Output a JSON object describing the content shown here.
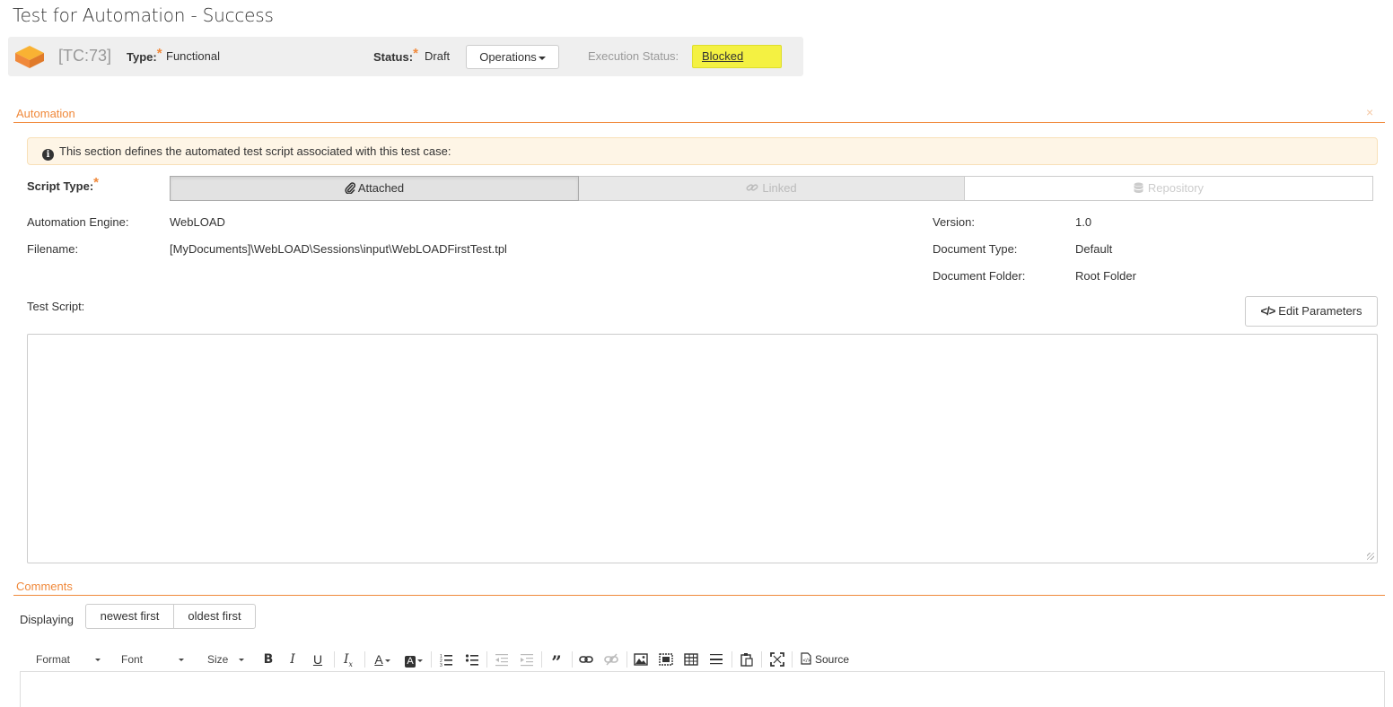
{
  "page": {
    "title": "Test for Automation - Success"
  },
  "header": {
    "id": "[TC:73]",
    "type_label": "Type:",
    "type_value": "Functional",
    "status_label": "Status:",
    "status_value": "Draft",
    "required_mark": "*",
    "operations_label": "Operations",
    "execution_status_label": "Execution Status:",
    "execution_status_value": "Blocked",
    "execution_status_color": "#f4f142",
    "icon": "test-case-box-icon"
  },
  "automation": {
    "section_title": "Automation",
    "close_icon": "×",
    "info_text": "This section defines the automated test script associated with this test case:",
    "script_type_label": "Script Type:",
    "script_types": [
      {
        "label": "Attached",
        "icon": "paperclip-icon",
        "active": true
      },
      {
        "label": "Linked",
        "icon": "link-icon",
        "active": false
      },
      {
        "label": "Repository",
        "icon": "database-icon",
        "active": false
      }
    ],
    "fields": {
      "engine_label": "Automation Engine:",
      "engine_value": "WebLOAD",
      "filename_label": "Filename:",
      "filename_value": "[MyDocuments]\\WebLOAD\\Sessions\\input\\WebLOADFirstTest.tpl",
      "version_label": "Version:",
      "version_value": "1.0",
      "doc_type_label": "Document Type:",
      "doc_type_value": "Default",
      "doc_folder_label": "Document Folder:",
      "doc_folder_value": "Root Folder"
    },
    "test_script_label": "Test Script:",
    "edit_parameters_label": "Edit Parameters",
    "test_script_value": ""
  },
  "comments": {
    "section_title": "Comments",
    "displaying_label": "Displaying",
    "sort_newest": "newest first",
    "sort_oldest": "oldest first",
    "toolbar": {
      "format": "Format",
      "font": "Font",
      "size": "Size",
      "source": "Source"
    }
  },
  "colors": {
    "accent": "#f0893b",
    "header_bg": "#efefef",
    "info_bg": "#fef5e6"
  }
}
